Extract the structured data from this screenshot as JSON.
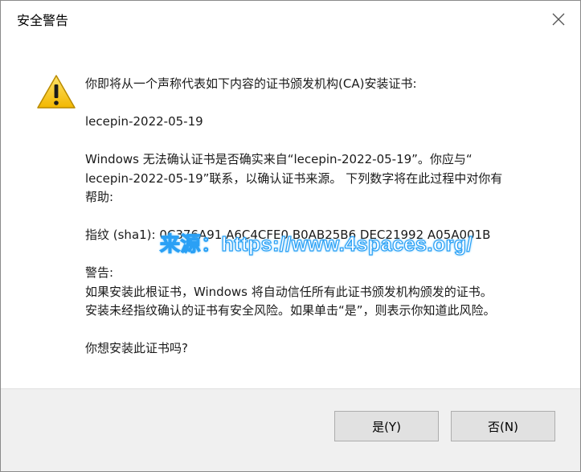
{
  "dialog": {
    "title": "安全警告",
    "close_icon": "close-icon",
    "warning_icon": "warning-triangle-icon"
  },
  "message": {
    "line1": "你即将从一个声称代表如下内容的证书颁发机构(CA)安装证书:",
    "issuer": "lecepin-2022-05-19",
    "verify_line1": "Windows 无法确认证书是否确实来自“lecepin-2022-05-19”。你应与“",
    "verify_line2": "lecepin-2022-05-19”联系，以确认证书来源。 下列数字将在此过程中对你有",
    "verify_line3": "帮助:",
    "thumbprint": "指纹 (sha1): 0C376A91 A6C4CFE0 B0AB25B6 DEC21992 A05A001B",
    "warning_heading": "警告:",
    "warning_line1": "如果安装此根证书，Windows 将自动信任所有此证书颁发机构颁发的证书。",
    "warning_line2": "安装未经指纹确认的证书有安全风险。如果单击“是”，则表示你知道此风险。",
    "question": "你想安装此证书吗?"
  },
  "watermark": {
    "text": "来源：https://www.4spaces.org/"
  },
  "buttons": {
    "yes_label": "是(Y)",
    "no_label": "否(N)"
  },
  "colors": {
    "footer_bg": "#f0f0f0",
    "button_bg": "#e1e1e1",
    "watermark_outline": "#2aa0f5",
    "warning_yellow": "#f5c400"
  }
}
